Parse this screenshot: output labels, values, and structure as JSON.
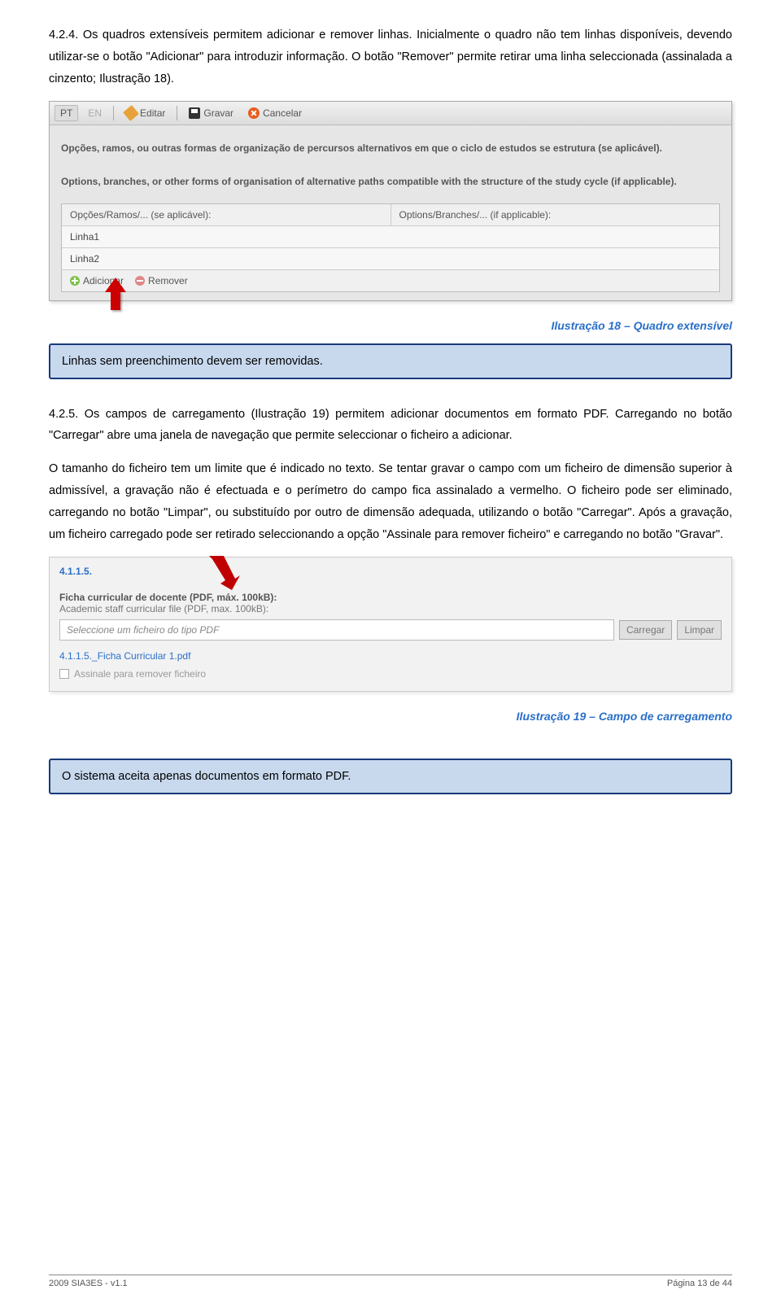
{
  "paragraphs": {
    "p1": "4.2.4.   Os quadros extensíveis permitem adicionar e remover linhas. Inicialmente o quadro não tem linhas disponíveis, devendo utilizar-se o botão \"Adicionar\" para introduzir informação. O botão \"Remover\" permite retirar uma linha seleccionada (assinalada a cinzento; Ilustração 18).",
    "p2": "4.2.5.   Os campos de carregamento (Ilustração 19) permitem adicionar documentos em formato PDF. Carregando no botão \"Carregar\" abre uma janela de navegação que permite seleccionar o ficheiro a adicionar.",
    "p3": "O tamanho do ficheiro tem um limite que é indicado no texto. Se tentar gravar o campo com um ficheiro de dimensão superior à admissível, a gravação não é efectuada e o perímetro do campo fica assinalado a vermelho. O ficheiro pode ser eliminado, carregando no botão \"Limpar\", ou substituído por outro de dimensão adequada, utilizando o botão \"Carregar\". Após a gravação, um ficheiro carregado pode ser retirado seleccionando a opção \"Assinale para remover ficheiro\" e carregando no botão \"Gravar\"."
  },
  "screenshot1": {
    "tabs": {
      "pt": "PT",
      "en": "EN"
    },
    "toolbar": {
      "editar": "Editar",
      "gravar": "Gravar",
      "cancelar": "Cancelar"
    },
    "desc_pt": "Opções, ramos, ou outras formas de organização de percursos alternativos em que o ciclo de estudos se estrutura (se aplicável).",
    "desc_en": "Options, branches, or other forms of organisation of alternative paths compatible with the structure of the study cycle (if applicable).",
    "table": {
      "header_pt": "Opções/Ramos/... (se aplicável):",
      "header_en": "Options/Branches/... (if applicable):",
      "rows": [
        "Linha1",
        "Linha2"
      ]
    },
    "buttons": {
      "adicionar": "Adicionar",
      "remover": "Remover"
    }
  },
  "captions": {
    "c18": "Ilustração 18 – Quadro extensível",
    "c19": "Ilustração 19 – Campo de carregamento"
  },
  "infobox1": "Linhas sem preenchimento devem ser removidas.",
  "infobox2": "O sistema aceita apenas documentos em formato PDF.",
  "screenshot2": {
    "section": "4.1.1.5.",
    "label_pt": "Ficha curricular de docente (PDF, máx. 100kB):",
    "label_en": "Academic staff curricular file (PDF, max. 100kB):",
    "placeholder": "Seleccione um ficheiro do tipo PDF",
    "btn_carregar": "Carregar",
    "btn_limpar": "Limpar",
    "file_link": "4.1.1.5._Ficha Curricular 1.pdf",
    "checkbox": "Assinale para remover ficheiro"
  },
  "footer": {
    "left": "2009 SIA3ES - v1.1",
    "right": "Página 13 de 44"
  }
}
